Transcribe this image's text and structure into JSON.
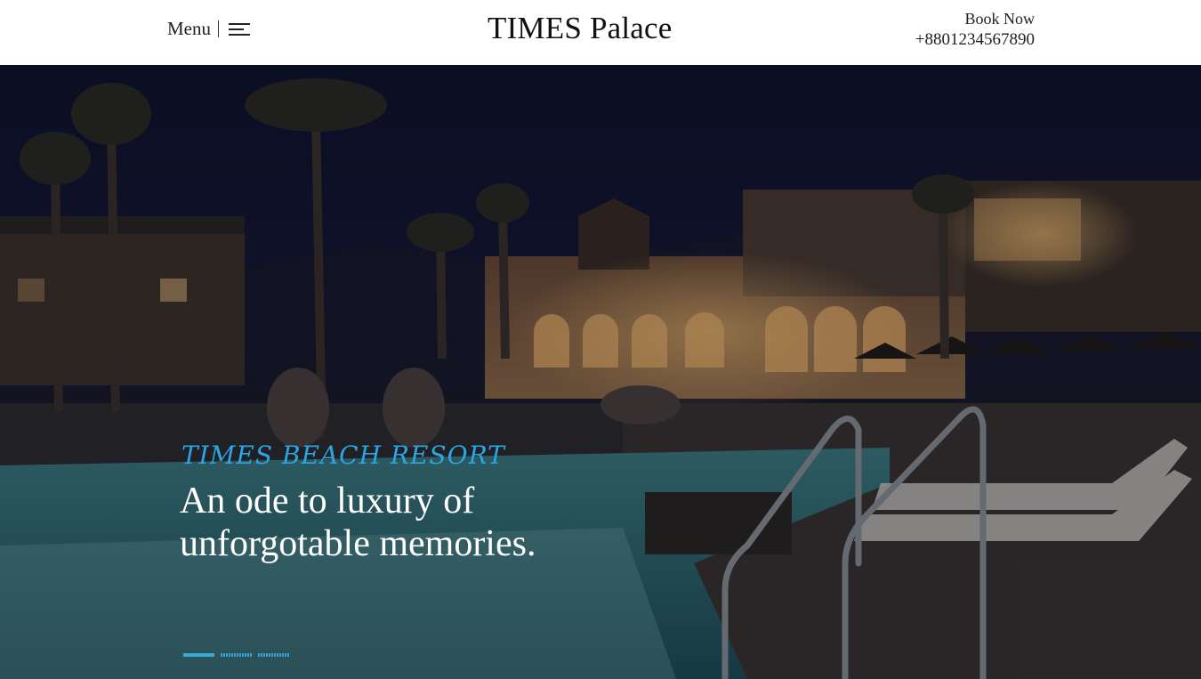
{
  "header": {
    "menu_label": "Menu",
    "brand": "TIMES Palace",
    "book_label": "Book Now",
    "phone": "+8801234567890"
  },
  "hero": {
    "eyebrow": "TIMES BEACH RESORT",
    "headline_line1": "An ode to luxury of",
    "headline_line2": "unforgotable memories.",
    "slides": [
      {
        "active": true
      },
      {
        "active": false
      },
      {
        "active": false
      }
    ]
  },
  "colors": {
    "accent": "#2aa6e4",
    "header_bg": "#ffffff",
    "hero_text": "#ffffff"
  },
  "icons": {
    "menu": "hamburger-icon"
  }
}
